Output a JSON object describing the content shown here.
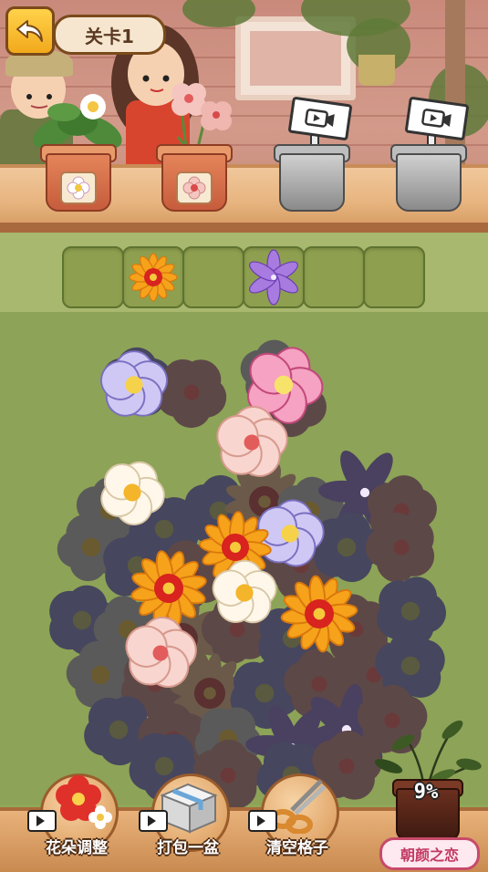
{
  "header": {
    "level_label": "关卡1",
    "back_icon": "back-arrow-icon"
  },
  "shelf": {
    "pots": [
      {
        "kind": "plant",
        "flower": "white-blossom"
      },
      {
        "kind": "plant",
        "flower": "pink-blossom"
      },
      {
        "kind": "locked-video",
        "icon": "video-play-icon"
      },
      {
        "kind": "locked-video",
        "icon": "video-play-icon"
      }
    ]
  },
  "slots": [
    {
      "flower": ""
    },
    {
      "flower": "orange-gerbera"
    },
    {
      "flower": ""
    },
    {
      "flower": "purple-lily"
    },
    {
      "flower": ""
    },
    {
      "flower": ""
    }
  ],
  "tools": [
    {
      "label": "花朵调整",
      "icon": "red-flower-icon",
      "video_icon": "video-camera-icon"
    },
    {
      "label": "打包一盆",
      "icon": "box-icon",
      "video_icon": "video-camera-icon"
    },
    {
      "label": "清空格子",
      "icon": "scissors-icon",
      "video_icon": "video-camera-icon"
    }
  ],
  "progress": {
    "percent_label": "9%",
    "value": 0.09
  },
  "flower_name": "朝颜之恋",
  "colors": {
    "accent_yellow": "#f2a91c",
    "pink_pill": "#c23a63",
    "field_green": "#8da357"
  }
}
